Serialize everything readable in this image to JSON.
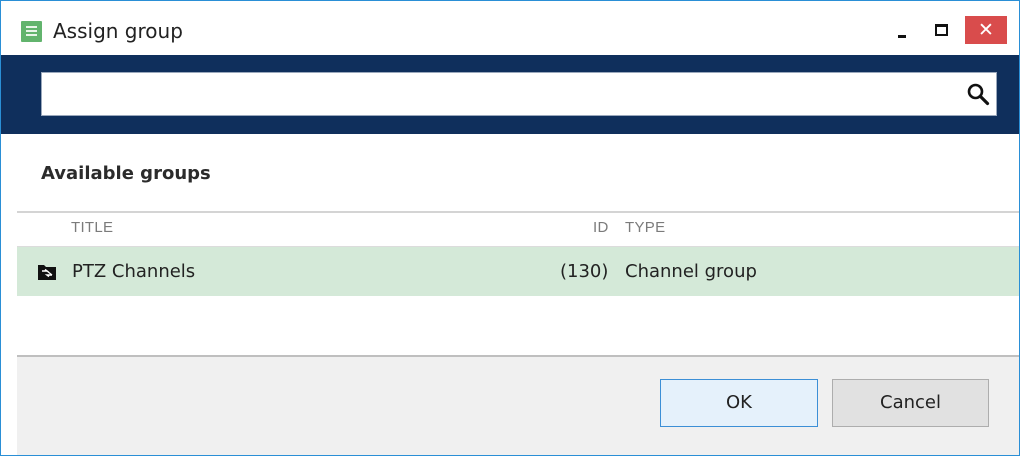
{
  "window": {
    "title": "Assign group",
    "close_glyph": "✕"
  },
  "search": {
    "placeholder": "",
    "value": ""
  },
  "groups": {
    "section_title": "Available groups",
    "columns": {
      "title": "TITLE",
      "id": "ID",
      "type": "TYPE"
    },
    "rows": [
      {
        "icon": "channel-group-icon",
        "title": "PTZ Channels",
        "id": "(130)",
        "type": "Channel group"
      }
    ]
  },
  "footer": {
    "ok_label": "OK",
    "cancel_label": "Cancel"
  },
  "colors": {
    "header_band": "#0f2f5c",
    "selected_row": "#d4e9d8",
    "close_button": "#d94c4c",
    "app_icon": "#62b46d"
  }
}
